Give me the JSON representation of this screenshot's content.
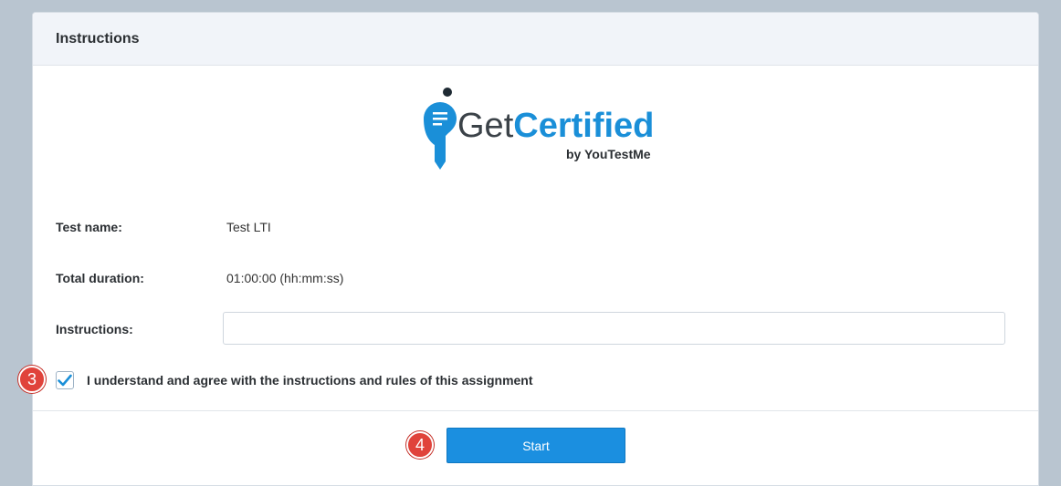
{
  "panel": {
    "title": "Instructions"
  },
  "logo": {
    "brand_prefix": "Get",
    "brand_main": "Certified",
    "tagline": "by YouTestMe",
    "colors": {
      "accent": "#1a8fd8",
      "dark": "#3b4248"
    }
  },
  "fields": {
    "test_name_label": "Test name:",
    "test_name_value": "Test LTI",
    "duration_label": "Total duration:",
    "duration_value": "01:00:00 (hh:mm:ss)",
    "instructions_label": "Instructions:",
    "instructions_value": ""
  },
  "agreement": {
    "checked": true,
    "text": "I understand and agree with the instructions and rules of this assignment"
  },
  "actions": {
    "start_label": "Start"
  },
  "step_markers": {
    "checkbox_step": "3",
    "start_step": "4"
  }
}
